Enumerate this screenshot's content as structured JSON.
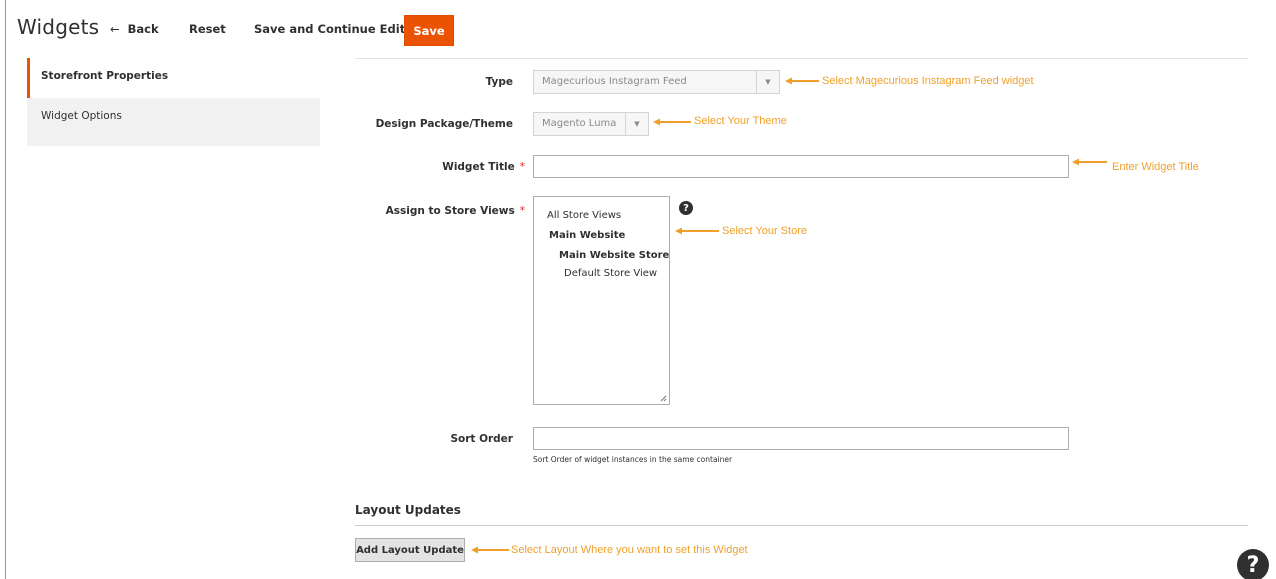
{
  "header": {
    "title": "Widgets",
    "back_arrow": "←",
    "back_label": "Back",
    "reset_label": "Reset",
    "save_continue_label": "Save and Continue Edit",
    "save_label": "Save"
  },
  "tabs": [
    {
      "label": "Storefront Properties",
      "active": true
    },
    {
      "label": "Widget Options",
      "active": false
    }
  ],
  "form": {
    "type": {
      "label": "Type",
      "value": "Magecurious Instagram Feed"
    },
    "theme": {
      "label": "Design Package/Theme",
      "value": "Magento Luma"
    },
    "widget_title": {
      "label": "Widget Title",
      "required_mark": "*",
      "value": ""
    },
    "store_views": {
      "label": "Assign to Store Views",
      "required_mark": "*",
      "options": [
        "All Store Views",
        "Main Website",
        "Main Website Store",
        "Default Store View"
      ],
      "help_icon": "question-circle-icon",
      "help_glyph": "?"
    },
    "sort_order": {
      "label": "Sort Order",
      "value": "",
      "note": "Sort Order of widget instances in the same container"
    }
  },
  "layout_updates": {
    "title": "Layout Updates",
    "add_button_label": "Add Layout Update"
  },
  "annotations": {
    "color": "#f0a02a",
    "type_note": "Select Magecurious Instagram Feed widget",
    "theme_note": "Select Your Theme",
    "title_note": "Enter Widget Title",
    "store_note": "Select Your Store",
    "layout_note": "Select Layout Where you want to set this Widget"
  },
  "footer": {
    "help_glyph": "?",
    "help_icon": "question-circle-icon"
  },
  "colors": {
    "accent": "#eb5202",
    "required": "#e22626",
    "text": "#303030"
  }
}
